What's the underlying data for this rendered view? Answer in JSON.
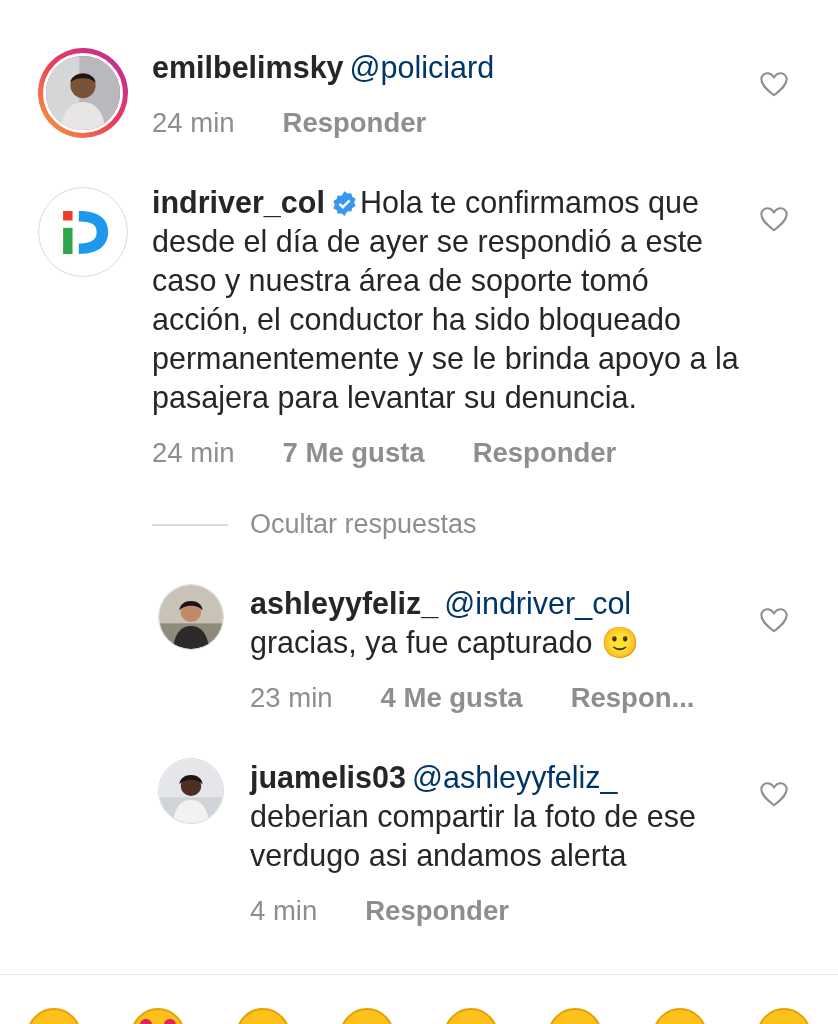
{
  "comments": [
    {
      "avatar": {
        "kind": "picture",
        "story_ring": true
      },
      "username": "emilbelimsky",
      "verified": false,
      "mention": "@policiard",
      "time": "24 min",
      "reply_label": "Responder"
    },
    {
      "avatar": {
        "kind": "logo",
        "story_ring": false
      },
      "username": "indriver_col",
      "verified": true,
      "text": "Hola te confirmamos que desde el día de ayer se respondió a este caso y nuestra área de soporte tomó acción, el conductor ha sido bloqueado permanentemente y se le brinda apoyo a la pasajera para levantar su denuncia.",
      "time": "24 min",
      "likes": "7 Me gusta",
      "reply_label": "Responder",
      "replies_toggle": "Ocultar respuestas",
      "replies": [
        {
          "avatar": {
            "kind": "picture",
            "story_ring": false
          },
          "username": "ashleyyfeliz_",
          "verified": false,
          "mention": "@indriver_col",
          "text": "gracias, ya fue capturado 🙂",
          "time": "23 min",
          "likes": "4 Me gusta",
          "reply_label": "Respon..."
        },
        {
          "avatar": {
            "kind": "picture",
            "story_ring": false
          },
          "username": "juamelis03",
          "verified": false,
          "mention": "@ashleyyfeliz_",
          "text": "deberian compartir la foto de ese verdugo asi andamos alerta",
          "time": "4 min",
          "reply_label": "Responder"
        }
      ]
    }
  ]
}
